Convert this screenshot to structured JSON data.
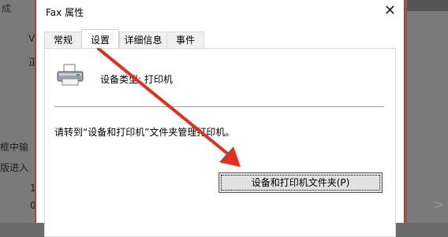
{
  "background": {
    "left_fragments": [
      "成",
      "V",
      "正",
      "框中输",
      "版进入",
      "1",
      "0"
    ],
    "right_fragments": [
      ">"
    ]
  },
  "dialog": {
    "title": "Fax 属性",
    "close_symbol": "✕",
    "tabs": [
      {
        "label": "常规",
        "active": false
      },
      {
        "label": "设置",
        "active": true
      },
      {
        "label": "详细信息",
        "active": false
      },
      {
        "label": "事件",
        "active": false
      }
    ],
    "device_type": "设备类型: 打印机",
    "info_text": "请转到“设备和打印机”文件夹管理打印机。",
    "folder_button_label": "设备和打印机文件夹(P)"
  },
  "colors": {
    "annotation_arrow": "#e0301e",
    "dialog_border": "#c0392b"
  },
  "icons": {
    "device": "printer-icon",
    "close": "close-icon"
  }
}
